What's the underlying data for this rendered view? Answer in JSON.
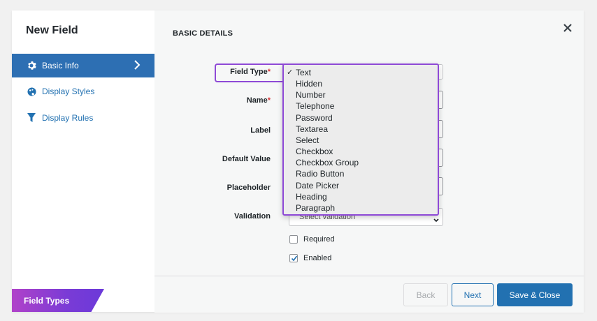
{
  "sidebar": {
    "title": "New Field",
    "items": [
      {
        "label": "Basic Info",
        "icon": "gear-icon",
        "active": true
      },
      {
        "label": "Display Styles",
        "icon": "palette-icon",
        "active": false
      },
      {
        "label": "Display Rules",
        "icon": "filter-icon",
        "active": false
      }
    ],
    "field_types_tab": "Field Types"
  },
  "main": {
    "section_heading": "BASIC DETAILS",
    "close_icon": "close-icon",
    "fields": {
      "field_type_label": "Field Type",
      "name_label": "Name",
      "label_label": "Label",
      "default_value_label": "Default Value",
      "placeholder_label": "Placeholder",
      "validation_label": "Validation",
      "validation_value": "Select validation",
      "required_marker": "*"
    },
    "checkboxes": [
      {
        "label": "Required",
        "checked": false
      },
      {
        "label": "Enabled",
        "checked": true
      }
    ]
  },
  "dropdown": {
    "selected": "Text",
    "options": [
      "Text",
      "Hidden",
      "Number",
      "Telephone",
      "Password",
      "Textarea",
      "Select",
      "Checkbox",
      "Checkbox Group",
      "Radio Button",
      "Date Picker",
      "Heading",
      "Paragraph"
    ]
  },
  "footer": {
    "back_label": "Back",
    "next_label": "Next",
    "save_label": "Save & Close"
  },
  "colors": {
    "accent": "#2271b1",
    "highlight": "#8e49d6",
    "required": "#d63638"
  }
}
